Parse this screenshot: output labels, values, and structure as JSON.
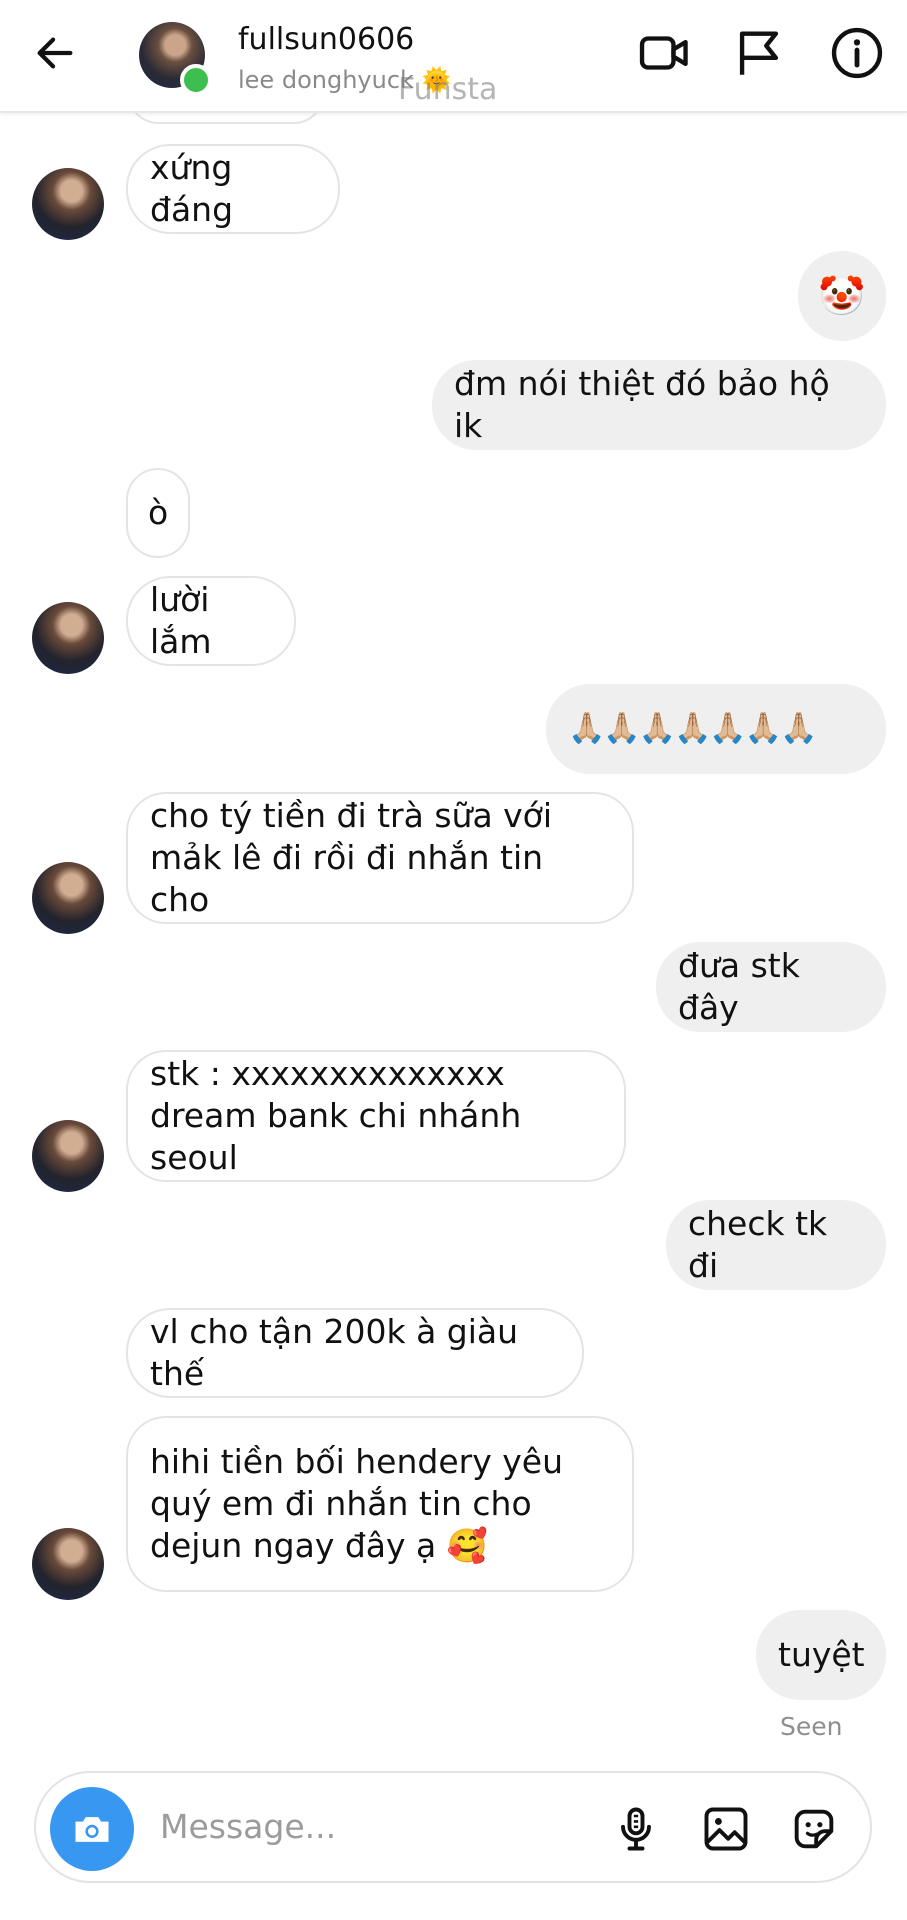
{
  "header": {
    "username": "fullsun0606",
    "subtitle": "lee donghyuck 🌞",
    "watermark": "Funsta",
    "icons": [
      "back-arrow-icon",
      "video-call-icon",
      "flag-icon",
      "info-icon"
    ]
  },
  "messages": [
    {
      "side": "in",
      "text": "xứng đáng"
    },
    {
      "side": "out",
      "text": "🤡"
    },
    {
      "side": "out",
      "text": "đm nói thiệt đó bảo hộ ik"
    },
    {
      "side": "in",
      "text": "ò"
    },
    {
      "side": "in",
      "text": "lười lắm"
    },
    {
      "side": "out",
      "text": "🙏🏼🙏🏼🙏🏼🙏🏼🙏🏼🙏🏼🙏🏼"
    },
    {
      "side": "in",
      "text": "cho tý tiền đi trà sữa với\nmảk lê đi rồi đi nhắn tin cho"
    },
    {
      "side": "out",
      "text": "đưa stk đây"
    },
    {
      "side": "in",
      "text": "stk : xxxxxxxxxxxxxx\ndream bank chi nhánh seoul"
    },
    {
      "side": "out",
      "text": "check tk đi"
    },
    {
      "side": "in",
      "text": "vl cho tận 200k à giàu thế"
    },
    {
      "side": "in",
      "text": "hihi tiền bối hendery yêu\nquý em đi nhắn tin cho\ndejun ngay đây ạ 🥰"
    },
    {
      "side": "out",
      "text": "tuyệt"
    }
  ],
  "status": {
    "seen": "Seen"
  },
  "composer": {
    "placeholder": "Message...",
    "icons": [
      "camera-icon",
      "microphone-icon",
      "gallery-icon",
      "sticker-icon"
    ]
  },
  "colors": {
    "online": "#3dbf4f",
    "camera_button": "#3897f0",
    "outgoing_bubble": "#efefef"
  }
}
